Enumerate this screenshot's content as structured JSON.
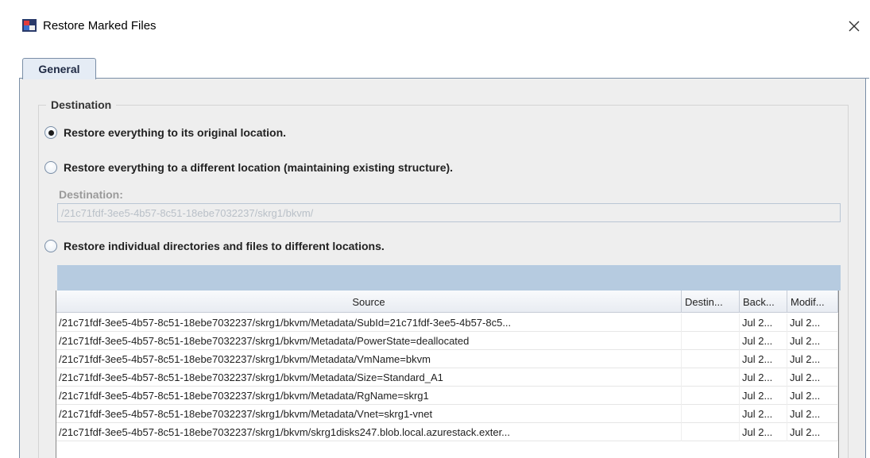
{
  "window": {
    "title": "Restore Marked Files",
    "icon": "app-icon",
    "close_icon": "close-icon"
  },
  "tabs": [
    {
      "label": "General",
      "active": true
    }
  ],
  "destination": {
    "group_title": "Destination",
    "options": [
      {
        "label": "Restore everything to its original location.",
        "selected": true
      },
      {
        "label": "Restore everything to a different location (maintaining existing structure).",
        "selected": false
      },
      {
        "label": "Restore individual directories and files to different locations.",
        "selected": false
      }
    ],
    "field_label": "Destination:",
    "field_value": "/21c71fdf-3ee5-4b57-8c51-18ebe7032237/skrg1/bkvm/"
  },
  "table": {
    "columns": [
      "Source",
      "Destin...",
      "Back...",
      "Modif..."
    ],
    "rows": [
      {
        "source": "/21c71fdf-3ee5-4b57-8c51-18ebe7032237/skrg1/bkvm/Metadata/SubId=21c71fdf-3ee5-4b57-8c5...",
        "destination": "",
        "backup": "Jul 2...",
        "modified": "Jul 2..."
      },
      {
        "source": "/21c71fdf-3ee5-4b57-8c51-18ebe7032237/skrg1/bkvm/Metadata/PowerState=deallocated",
        "destination": "",
        "backup": "Jul 2...",
        "modified": "Jul 2..."
      },
      {
        "source": "/21c71fdf-3ee5-4b57-8c51-18ebe7032237/skrg1/bkvm/Metadata/VmName=bkvm",
        "destination": "",
        "backup": "Jul 2...",
        "modified": "Jul 2..."
      },
      {
        "source": "/21c71fdf-3ee5-4b57-8c51-18ebe7032237/skrg1/bkvm/Metadata/Size=Standard_A1",
        "destination": "",
        "backup": "Jul 2...",
        "modified": "Jul 2..."
      },
      {
        "source": "/21c71fdf-3ee5-4b57-8c51-18ebe7032237/skrg1/bkvm/Metadata/RgName=skrg1",
        "destination": "",
        "backup": "Jul 2...",
        "modified": "Jul 2..."
      },
      {
        "source": "/21c71fdf-3ee5-4b57-8c51-18ebe7032237/skrg1/bkvm/Metadata/Vnet=skrg1-vnet",
        "destination": "",
        "backup": "Jul 2...",
        "modified": "Jul 2..."
      },
      {
        "source": "/21c71fdf-3ee5-4b57-8c51-18ebe7032237/skrg1/bkvm/skrg1disks247.blob.local.azurestack.exter...",
        "destination": "",
        "backup": "Jul 2...",
        "modified": "Jul 2..."
      }
    ]
  },
  "colors": {
    "tab_bg": "#e5ecf5",
    "border": "#7a8ea6",
    "panel_bg": "#eeeeee",
    "table_band": "#b6cbe0",
    "disabled_text": "#9a9a9a"
  }
}
